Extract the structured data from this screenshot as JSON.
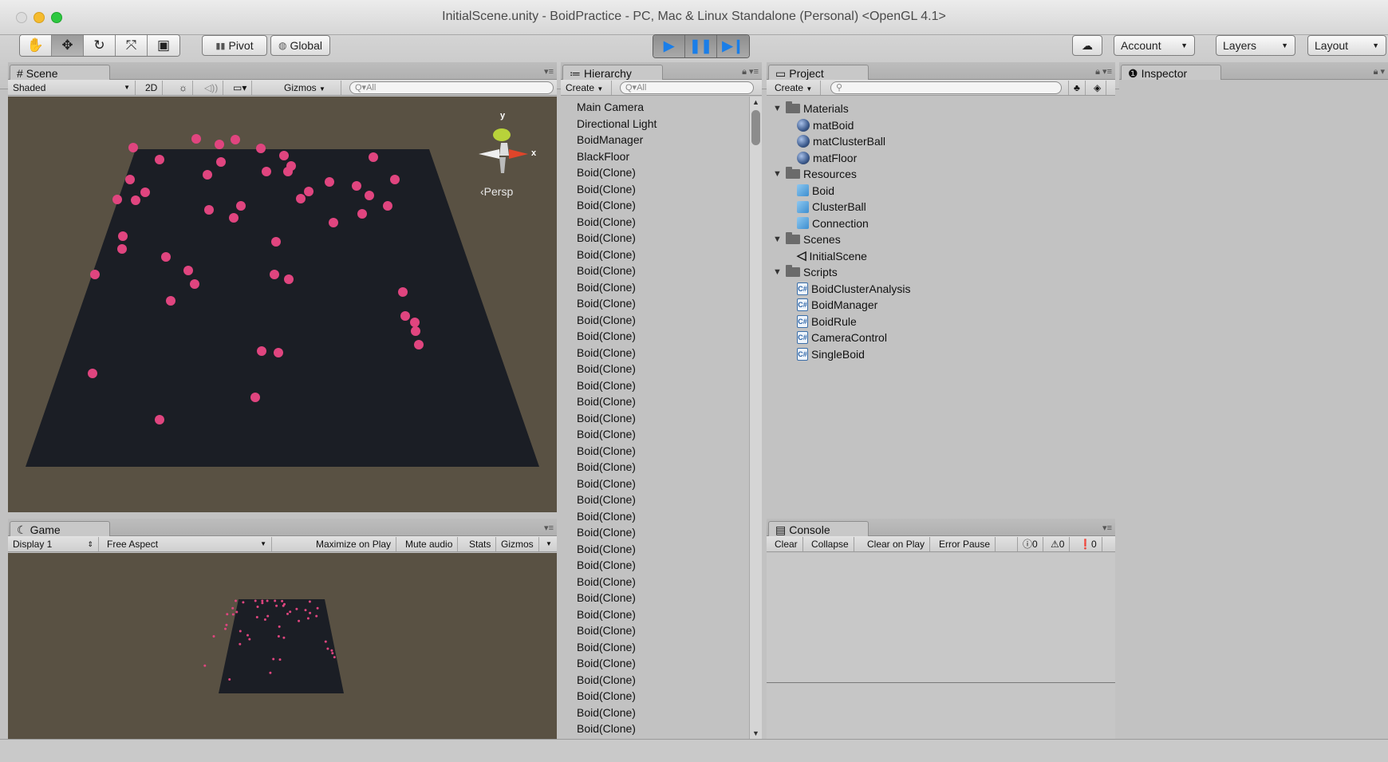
{
  "window": {
    "title": "InitialScene.unity - BoidPractice - PC, Mac & Linux Standalone (Personal) <OpenGL 4.1>"
  },
  "toolbar": {
    "transform_tools": [
      "hand-icon",
      "move-icon",
      "rotate-icon",
      "scale-icon",
      "rect-icon"
    ],
    "pivot_label": "Pivot",
    "global_label": "Global",
    "account_label": "Account",
    "layers_label": "Layers",
    "layout_label": "Layout"
  },
  "scene": {
    "tab_label": "Scene",
    "shading": "Shaded",
    "mode_2d": "2D",
    "gizmos_label": "Gizmos",
    "search_placeholder": "Q▾All",
    "persp_label": "‹Persp",
    "gizmo_y": "y",
    "gizmo_x": "x"
  },
  "game": {
    "tab_label": "Game",
    "display": "Display 1",
    "aspect": "Free Aspect",
    "maximize_label": "Maximize on Play",
    "mute_label": "Mute audio",
    "stats_label": "Stats",
    "gizmos_label": "Gizmos"
  },
  "hierarchy": {
    "tab_label": "Hierarchy",
    "create_label": "Create",
    "search_placeholder": "Q▾All",
    "items": [
      "Main Camera",
      "Directional Light",
      "BoidManager",
      "BlackFloor",
      "Boid(Clone)",
      "Boid(Clone)",
      "Boid(Clone)",
      "Boid(Clone)",
      "Boid(Clone)",
      "Boid(Clone)",
      "Boid(Clone)",
      "Boid(Clone)",
      "Boid(Clone)",
      "Boid(Clone)",
      "Boid(Clone)",
      "Boid(Clone)",
      "Boid(Clone)",
      "Boid(Clone)",
      "Boid(Clone)",
      "Boid(Clone)",
      "Boid(Clone)",
      "Boid(Clone)",
      "Boid(Clone)",
      "Boid(Clone)",
      "Boid(Clone)",
      "Boid(Clone)",
      "Boid(Clone)",
      "Boid(Clone)",
      "Boid(Clone)",
      "Boid(Clone)",
      "Boid(Clone)",
      "Boid(Clone)",
      "Boid(Clone)",
      "Boid(Clone)",
      "Boid(Clone)",
      "Boid(Clone)",
      "Boid(Clone)",
      "Boid(Clone)",
      "Boid(Clone)",
      "Boid(Clone)"
    ]
  },
  "project": {
    "tab_label": "Project",
    "create_label": "Create",
    "tree": [
      {
        "label": "Materials",
        "kind": "folder"
      },
      {
        "label": "matBoid",
        "kind": "material"
      },
      {
        "label": "matClusterBall",
        "kind": "material"
      },
      {
        "label": "matFloor",
        "kind": "material"
      },
      {
        "label": "Resources",
        "kind": "folder"
      },
      {
        "label": "Boid",
        "kind": "prefab"
      },
      {
        "label": "ClusterBall",
        "kind": "prefab"
      },
      {
        "label": "Connection",
        "kind": "prefab"
      },
      {
        "label": "Scenes",
        "kind": "folder"
      },
      {
        "label": "InitialScene",
        "kind": "scene"
      },
      {
        "label": "Scripts",
        "kind": "folder"
      },
      {
        "label": "BoidClusterAnalysis",
        "kind": "script"
      },
      {
        "label": "BoidManager",
        "kind": "script"
      },
      {
        "label": "BoidRule",
        "kind": "script"
      },
      {
        "label": "CameraControl",
        "kind": "script"
      },
      {
        "label": "SingleBoid",
        "kind": "script"
      }
    ]
  },
  "inspector": {
    "tab_label": "Inspector"
  },
  "console": {
    "tab_label": "Console",
    "clear_label": "Clear",
    "collapse_label": "Collapse",
    "clear_on_play_label": "Clear on Play",
    "error_pause_label": "Error Pause",
    "info_count": "0",
    "warning_count": "0",
    "error_count": "0"
  },
  "colors": {
    "play_accent": "#1a7ee8",
    "floor": "#1b1e25",
    "boid": "#e0457f",
    "ground": "#595143"
  }
}
